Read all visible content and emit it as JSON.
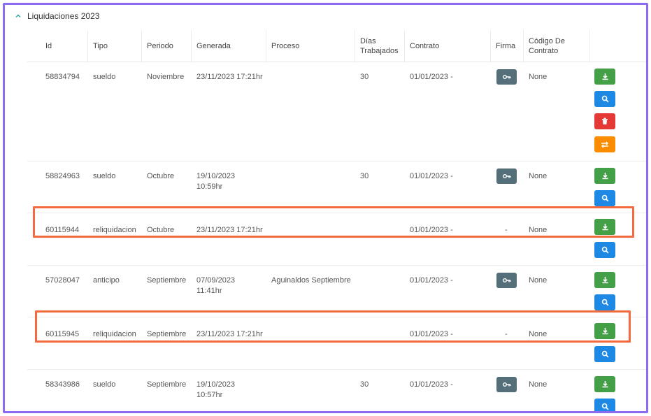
{
  "section": {
    "title": "Liquidaciones 2023"
  },
  "columns": {
    "id": "Id",
    "tipo": "Tipo",
    "periodo": "Periodo",
    "generada": "Generada",
    "proceso": "Proceso",
    "dias_1": "Días",
    "dias_2": "Trabajados",
    "contrato": "Contrato",
    "firma": "Firma",
    "codigo_1": "Código De",
    "codigo_2": "Contrato"
  },
  "rows": [
    {
      "id": "58834794",
      "tipo": "sueldo",
      "periodo": "Noviembre",
      "gen_1": "23/11/2023 17:21hr",
      "gen_2": "",
      "proceso": "",
      "dias": "30",
      "contrato": "01/01/2023 -",
      "firma": "",
      "codigo": "None"
    },
    {
      "id": "58824963",
      "tipo": "sueldo",
      "periodo": "Octubre",
      "gen_1": "19/10/2023",
      "gen_2": "10:59hr",
      "proceso": "",
      "dias": "30",
      "contrato": "01/01/2023 -",
      "firma": "",
      "codigo": "None"
    },
    {
      "id": "60115944",
      "tipo": "reliquidacion",
      "periodo": "Octubre",
      "gen_1": "23/11/2023 17:21hr",
      "gen_2": "",
      "proceso": "",
      "dias": "",
      "contrato": "01/01/2023 -",
      "firma": "-",
      "codigo": "None"
    },
    {
      "id": "57028047",
      "tipo": "anticipo",
      "periodo": "Septiembre",
      "gen_1": "07/09/2023",
      "gen_2": "11:41hr",
      "proceso": "Aguinaldos Septiembre",
      "dias": "",
      "contrato": "01/01/2023 -",
      "firma": "",
      "codigo": "None"
    },
    {
      "id": "60115945",
      "tipo": "reliquidacion",
      "periodo": "Septiembre",
      "gen_1": "23/11/2023 17:21hr",
      "gen_2": "",
      "proceso": "",
      "dias": "",
      "contrato": "01/01/2023 -",
      "firma": "-",
      "codigo": "None"
    },
    {
      "id": "58343986",
      "tipo": "sueldo",
      "periodo": "Septiembre",
      "gen_1": "19/10/2023",
      "gen_2": "10:57hr",
      "proceso": "",
      "dias": "30",
      "contrato": "01/01/2023 -",
      "firma": "",
      "codigo": "None"
    }
  ],
  "colors": {
    "frame": "#8b6cf2",
    "highlight": "#f26a3d",
    "download": "#43a047",
    "view": "#1e88e5",
    "delete": "#e53935",
    "swap": "#fb8c00",
    "signature": "#546e7a"
  },
  "icons": {
    "collapse": "chevron-up-icon",
    "signature": "key-icon",
    "download": "download-icon",
    "view": "search-icon",
    "delete": "trash-icon",
    "swap": "swap-icon"
  }
}
